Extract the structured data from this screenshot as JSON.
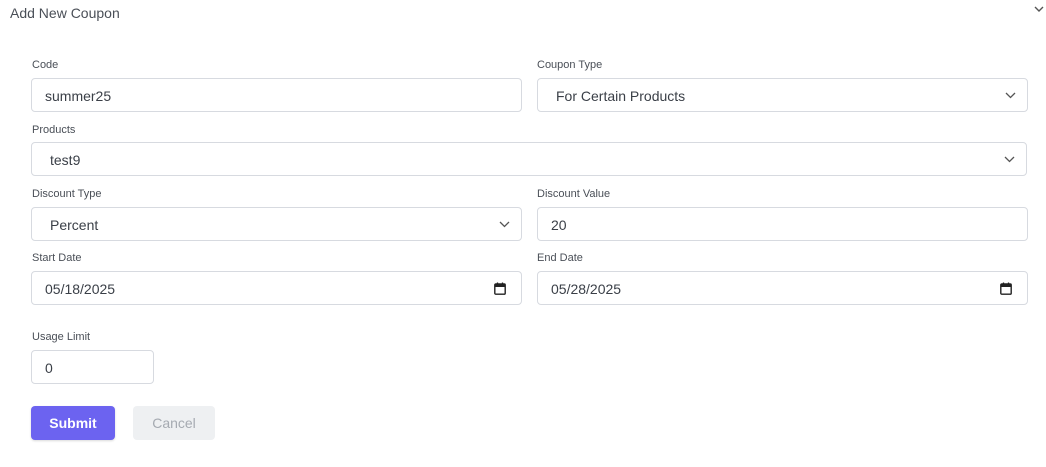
{
  "header": {
    "title": "Add New Coupon",
    "toggle_icon": "chevron-down-icon"
  },
  "form": {
    "code": {
      "label": "Code",
      "value": "summer25"
    },
    "coupon_type": {
      "label": "Coupon Type",
      "value": "For Certain Products"
    },
    "products": {
      "label": "Products",
      "value": "test9"
    },
    "discount_type": {
      "label": "Discount Type",
      "value": "Percent"
    },
    "discount_value": {
      "label": "Discount Value",
      "value": "20"
    },
    "start_date": {
      "label": "Start Date",
      "value": "05/18/2025"
    },
    "end_date": {
      "label": "End Date",
      "value": "05/28/2025"
    },
    "usage_limit": {
      "label": "Usage Limit",
      "value": "0"
    }
  },
  "actions": {
    "submit_label": "Submit",
    "cancel_label": "Cancel"
  },
  "colors": {
    "accent": "#6c63f0",
    "cancel_bg": "#eef0f2",
    "border": "#d7dae0"
  }
}
